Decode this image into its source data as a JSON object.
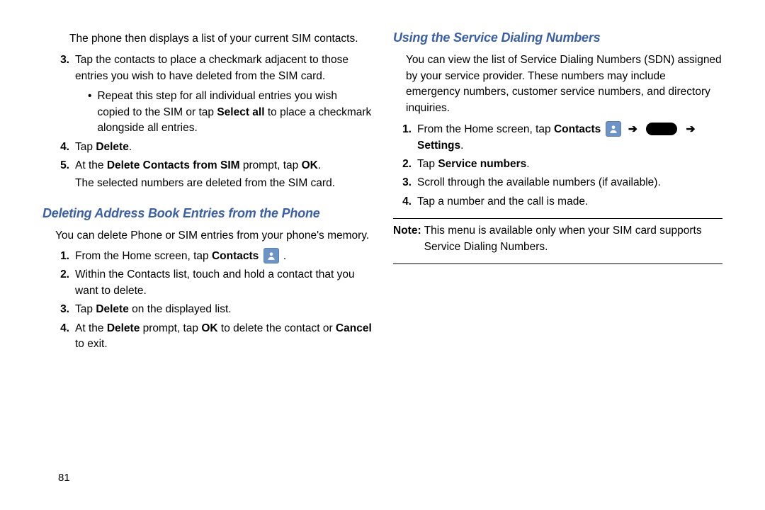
{
  "left": {
    "intro1": "The phone then displays a list of your current SIM contacts.",
    "steps": [
      {
        "num": "3.",
        "pre": "Tap the contacts to place a checkmark adjacent to those entries you wish to have deleted from the SIM card.",
        "bullet_pre": "Repeat this step for all individual entries you wish copied to the SIM or tap ",
        "bullet_bold": "Select all",
        "bullet_post": " to place a checkmark alongside all entries."
      },
      {
        "num": "4.",
        "pre": "Tap ",
        "b1": "Delete",
        "post": "."
      },
      {
        "num": "5.",
        "pre": "At the ",
        "b1": "Delete Contacts from SIM",
        "mid": " prompt, tap ",
        "b2": "OK",
        "post": ".",
        "tail": "The selected numbers are deleted from the SIM card."
      }
    ],
    "heading": "Deleting Address Book Entries from the Phone",
    "intro2": "You can delete Phone or SIM entries from your phone's memory.",
    "steps2": [
      {
        "num": "1.",
        "pre": "From the Home screen, tap ",
        "b1": "Contacts",
        "icon": "contact",
        "post": " ."
      },
      {
        "num": "2.",
        "pre": "Within the Contacts list, touch and hold a contact that you want to delete."
      },
      {
        "num": "3.",
        "pre": "Tap ",
        "b1": "Delete",
        "post": " on the displayed list."
      },
      {
        "num": "4.",
        "pre": "At the ",
        "b1": "Delete",
        "mid": " prompt, tap ",
        "b2": "OK",
        "mid2": " to delete the contact or ",
        "b3": "Cancel",
        "post": " to exit."
      }
    ]
  },
  "right": {
    "heading": "Using the Service Dialing Numbers",
    "intro": "You can view the list of Service Dialing Numbers (SDN) assigned by your service provider. These numbers may include emergency numbers, customer service numbers, and directory inquiries.",
    "steps": [
      {
        "num": "1.",
        "pre": "From the Home screen, tap ",
        "b1": "Contacts",
        "icon": "contact",
        "arrow": "➔",
        "icon2": "menu",
        "arrow2": "➔",
        "b2": "Settings",
        "post": "."
      },
      {
        "num": "2.",
        "pre": "Tap ",
        "b1": "Service numbers",
        "post": "."
      },
      {
        "num": "3.",
        "pre": "Scroll through the available numbers (if available)."
      },
      {
        "num": "4.",
        "pre": "Tap a number and the call is made."
      }
    ],
    "note_label": "Note:",
    "note": "This menu is available only when your SIM card supports Service Dialing Numbers."
  },
  "page": "81"
}
